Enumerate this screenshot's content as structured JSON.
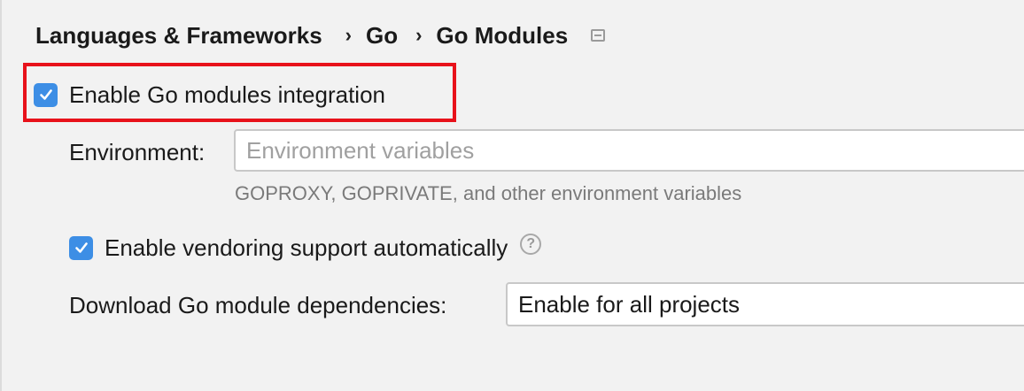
{
  "breadcrumb": {
    "items": [
      "Languages & Frameworks",
      "Go",
      "Go Modules"
    ],
    "separator": "›"
  },
  "modules_integration": {
    "label": "Enable Go modules integration",
    "checked": true
  },
  "environment": {
    "label": "Environment:",
    "placeholder": "Environment variables",
    "value": "",
    "hint": "GOPROXY, GOPRIVATE, and other environment variables"
  },
  "vendoring": {
    "label": "Enable vendoring support automatically",
    "checked": true,
    "help_symbol": "?"
  },
  "download": {
    "label": "Download Go module dependencies:",
    "selected": "Enable for all projects"
  },
  "colors": {
    "checkbox": "#3d8ee5",
    "highlight": "#e8121b",
    "background": "#f2f2f2"
  },
  "icons": {
    "breadcrumb_end": "page-layout-icon",
    "checkbox": "checkmark-icon",
    "help": "help-icon"
  }
}
